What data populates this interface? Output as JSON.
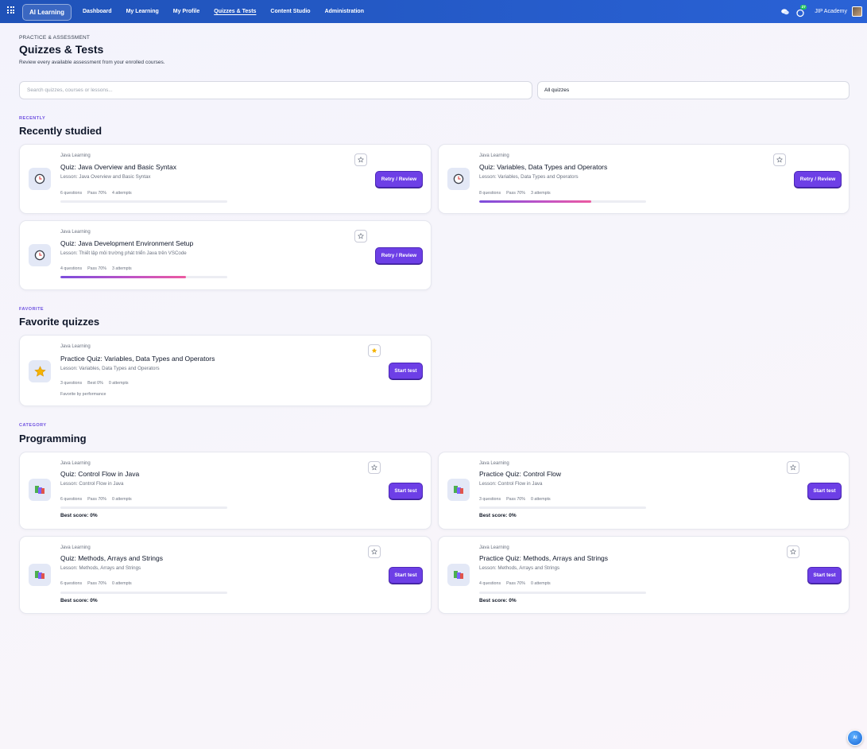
{
  "nav": {
    "brand": "AI Learning",
    "links": [
      "Dashboard",
      "My Learning",
      "My Profile",
      "Quizzes & Tests",
      "Content Studio",
      "Administration"
    ],
    "active": "Quizzes & Tests",
    "notification_count": "27",
    "account": "JIP Academy"
  },
  "header": {
    "eyebrow": "PRACTICE & ASSESSMENT",
    "title": "Quizzes & Tests",
    "subtitle": "Review every available assessment from your enrolled courses."
  },
  "search": {
    "placeholder": "Search quizzes, courses or lessons...",
    "value": ""
  },
  "filter": {
    "selected": "All quizzes"
  },
  "sections": {
    "recent": {
      "eyebrow": "RECENTLY",
      "title": "Recently studied",
      "cards": [
        {
          "course": "Java Learning",
          "title": "Quiz: Java Overview and Basic Syntax",
          "lesson": "Lesson: Java Overview and Basic Syntax",
          "questions": "6 questions",
          "pass": "Pass 70%",
          "attempts": "4 attempts",
          "progress": 0,
          "action": "Retry / Review",
          "icon": "clock-icon",
          "favorite": false
        },
        {
          "course": "Java Learning",
          "title": "Quiz: Variables, Data Types and Operators",
          "lesson": "Lesson: Variables, Data Types and Operators",
          "questions": "8 questions",
          "pass": "Pass 70%",
          "attempts": "3 attempts",
          "progress": 0.67,
          "action": "Retry / Review",
          "icon": "clock-icon",
          "favorite": false
        },
        {
          "course": "Java Learning",
          "title": "Quiz: Java Development Environment Setup",
          "lesson": "Lesson: Thiết lập môi trường phát triển Java trên VSCode",
          "questions": "4 questions",
          "pass": "Pass 70%",
          "attempts": "3 attempts",
          "progress": 0.75,
          "action": "Retry / Review",
          "icon": "clock-icon",
          "favorite": false
        }
      ]
    },
    "favorite": {
      "eyebrow": "FAVORITE",
      "title": "Favorite quizzes",
      "cards": [
        {
          "course": "Java Learning",
          "title": "Practice Quiz: Variables, Data Types and Operators",
          "lesson": "Lesson: Variables, Data Types and Operators",
          "questions": "3 questions",
          "best": "Best 0%",
          "attempts": "0 attempts",
          "extra": "Favorite by performance",
          "action": "Start test",
          "icon": "star-icon",
          "favorite": true
        }
      ]
    },
    "category": {
      "eyebrow": "CATEGORY",
      "title": "Programming",
      "cards": [
        {
          "course": "Java Learning",
          "title": "Quiz: Control Flow in Java",
          "lesson": "Lesson: Control Flow in Java",
          "questions": "6 questions",
          "pass": "Pass 70%",
          "attempts": "0 attempts",
          "best_score": "Best score: 0%",
          "progress": 0,
          "action": "Start test",
          "icon": "books-icon",
          "favorite": false
        },
        {
          "course": "Java Learning",
          "title": "Practice Quiz: Control Flow",
          "lesson": "Lesson: Control Flow in Java",
          "questions": "3 questions",
          "pass": "Pass 70%",
          "attempts": "0 attempts",
          "best_score": "Best score: 0%",
          "progress": 0,
          "action": "Start test",
          "icon": "books-icon",
          "favorite": false
        },
        {
          "course": "Java Learning",
          "title": "Quiz: Methods, Arrays and Strings",
          "lesson": "Lesson: Methods, Arrays and Strings",
          "questions": "6 questions",
          "pass": "Pass 70%",
          "attempts": "0 attempts",
          "best_score": "Best score: 0%",
          "progress": 0,
          "action": "Start test",
          "icon": "books-icon",
          "favorite": false
        },
        {
          "course": "Java Learning",
          "title": "Practice Quiz: Methods, Arrays and Strings",
          "lesson": "Lesson: Methods, Arrays and Strings",
          "questions": "4 questions",
          "pass": "Pass 70%",
          "attempts": "0 attempts",
          "best_score": "Best score: 0%",
          "progress": 0,
          "action": "Start test",
          "icon": "books-icon",
          "favorite": false
        }
      ]
    }
  },
  "colors": {
    "topbar": "#2a62d6",
    "accent": "#6d3fe6",
    "progress_start": "#7c4ddc",
    "progress_end": "#ec5aa0",
    "favorite_star": "#f5b301"
  },
  "helper_icon": "ai-assistant-icon"
}
